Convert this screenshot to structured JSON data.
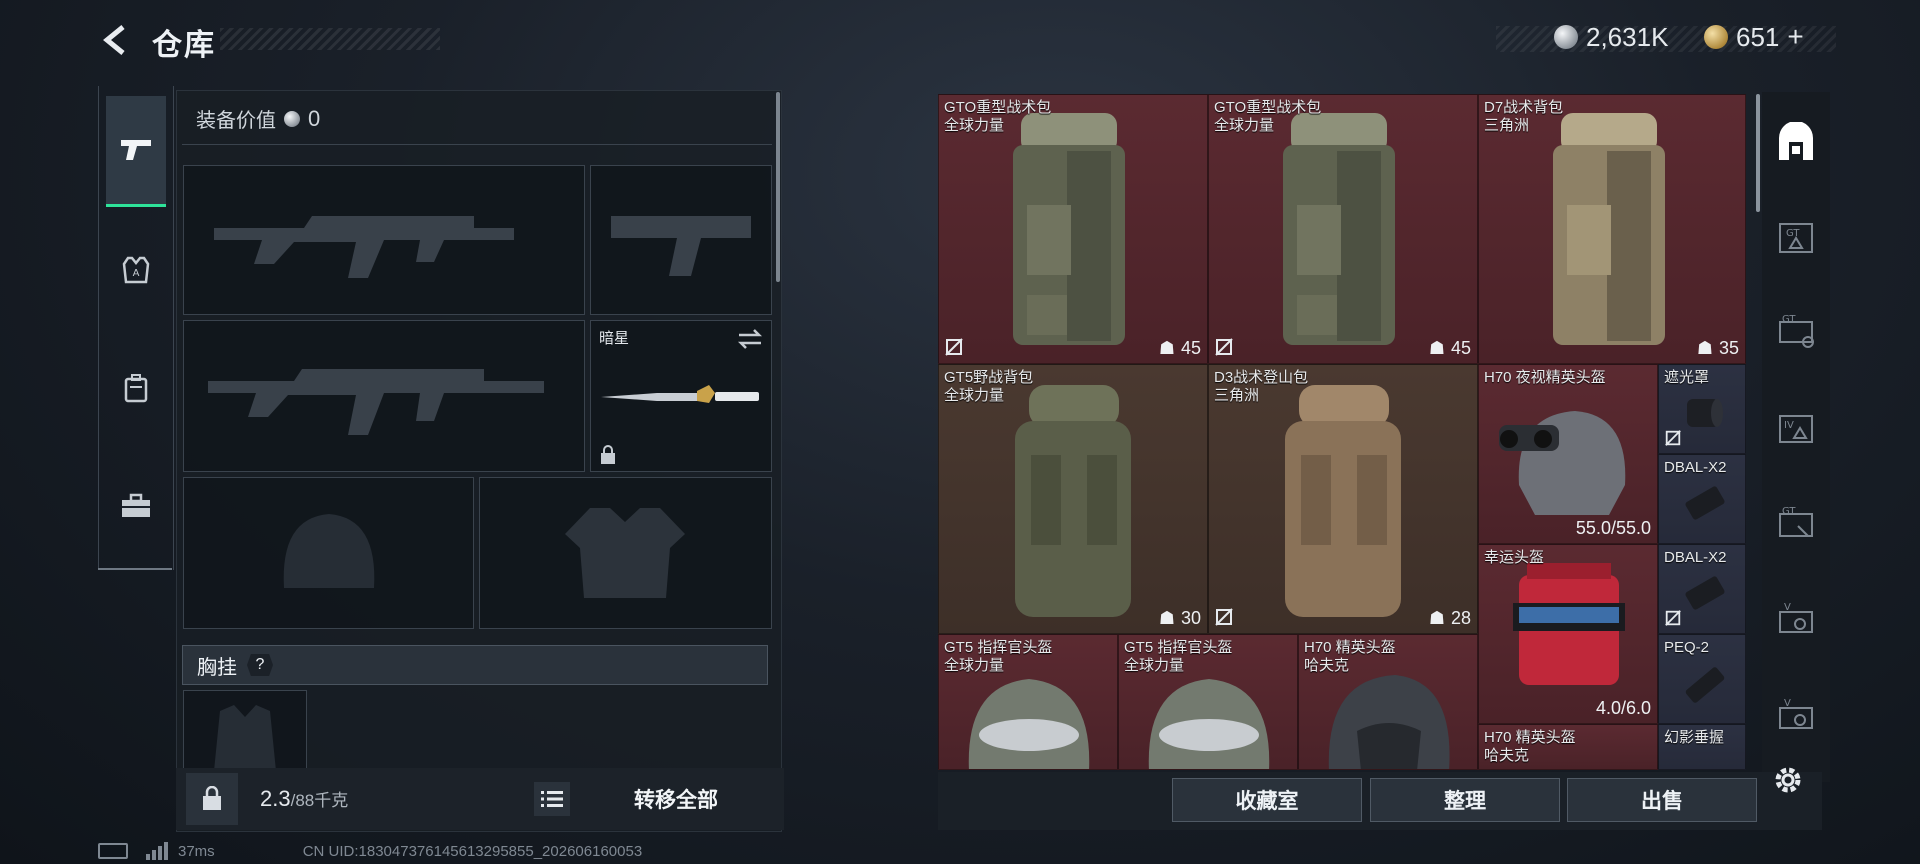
{
  "header": {
    "title": "仓库",
    "silver": "2,631K",
    "gold": "651",
    "gold_plus": "+"
  },
  "left_tabs": [
    "pistol-tab",
    "armor-tab",
    "backpack-tab",
    "toolbox-tab"
  ],
  "loadout": {
    "equip_value_label": "装备价值",
    "equip_value": "0",
    "melee_name": "暗星",
    "chest_rig_label": "胸挂",
    "help": "?"
  },
  "footer_left": {
    "weight": "2.3",
    "capacity": "/88千克",
    "transfer_all": "转移全部"
  },
  "status": {
    "ping": "37ms",
    "uid": "CN UID:183047376145613295855_202606160053"
  },
  "storage": [
    {
      "name": "GTO重型战术包",
      "sub": "全球力量",
      "count": "45",
      "no_insure": true
    },
    {
      "name": "GTO重型战术包",
      "sub": "全球力量",
      "count": "45",
      "no_insure": true
    },
    {
      "name": "D7战术背包",
      "sub": "三角洲",
      "count": "35",
      "no_insure": false
    },
    {
      "name": "GT5野战背包",
      "sub": "全球力量",
      "count": "30",
      "no_insure": false
    },
    {
      "name": "D3战术登山包",
      "sub": "三角洲",
      "count": "28",
      "no_insure": true
    },
    {
      "name": "H70 夜视精英头盔",
      "sub": "",
      "durability": "55.0/55.0"
    },
    {
      "name": "遮光罩",
      "sub": "",
      "no_insure": true
    },
    {
      "name": "DBAL-X2",
      "sub": ""
    },
    {
      "name": "幸运头盔",
      "sub": "",
      "durability": "4.0/6.0"
    },
    {
      "name": "DBAL-X2",
      "sub": "",
      "no_insure": true
    },
    {
      "name": "PEQ-2",
      "sub": ""
    },
    {
      "name": "GT5 指挥官头盔",
      "sub": "全球力量"
    },
    {
      "name": "GT5 指挥官头盔",
      "sub": "全球力量"
    },
    {
      "name": "H70 精英头盔",
      "sub": "哈夫克"
    },
    {
      "name": "H70 精英头盔",
      "sub": "哈夫克"
    },
    {
      "name": "幻影垂握",
      "sub": ""
    }
  ],
  "buttons": {
    "collection": "收藏室",
    "organize": "整理",
    "sell": "出售"
  },
  "colors": {
    "accent_green": "#2ee39a",
    "rarity_red": "#5b2a31",
    "rarity_brown": "#4a3930",
    "rarity_navy": "#2c3142"
  }
}
